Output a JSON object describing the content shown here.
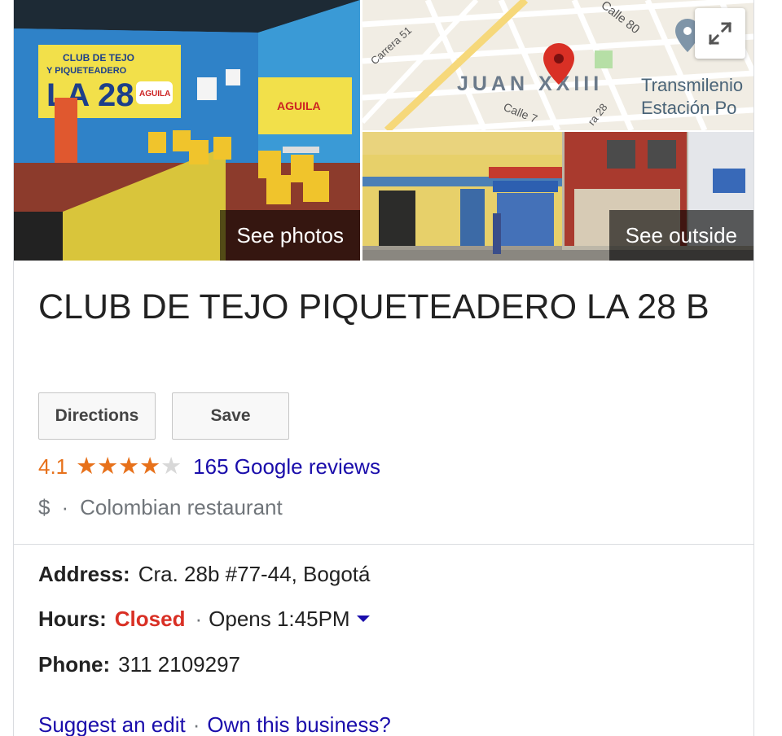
{
  "media": {
    "photos_label": "See photos",
    "outside_label": "See outside",
    "map": {
      "neighborhood": "JUAN XXIII",
      "streets": [
        "Carrera 51",
        "Calle 80",
        "Calle 7",
        "ra 28"
      ],
      "transit_label_1": "Transmilenio",
      "transit_label_2": "Estación Po",
      "expand_icon": "expand-arrows-icon",
      "pin_color": "#d93025"
    },
    "interior_signs": [
      "CLUB DE TEJO",
      "Y PIQUETEADERO",
      "LA 28",
      "AGUILA",
      "AGUILA"
    ]
  },
  "place": {
    "title": "CLUB DE TEJO PIQUETEADERO LA 28 B",
    "actions": {
      "directions": "Directions",
      "save": "Save"
    },
    "rating": {
      "value": "4.1",
      "stars": 4.1,
      "max": 5,
      "reviews": "165 Google reviews",
      "color": "#e7711b"
    },
    "price": "$",
    "category": "Colombian restaurant"
  },
  "info": {
    "address_label": "Address:",
    "address": "Cra. 28b #77-44, Bogotá",
    "hours_label": "Hours:",
    "hours_status": "Closed",
    "hours_next": "Opens 1:45PM",
    "phone_label": "Phone:",
    "phone": "311 2109297"
  },
  "links": {
    "suggest_edit": "Suggest an edit",
    "own_business": "Own this business?"
  },
  "colors": {
    "link": "#1a0dab",
    "closed": "#d93025",
    "muted": "#70757a"
  }
}
